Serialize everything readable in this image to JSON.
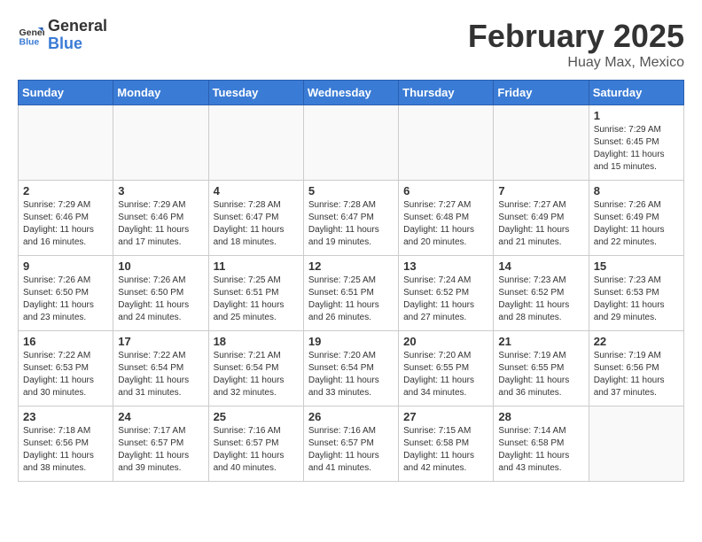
{
  "header": {
    "logo_line1": "General",
    "logo_line2": "Blue",
    "title": "February 2025",
    "subtitle": "Huay Max, Mexico"
  },
  "days_of_week": [
    "Sunday",
    "Monday",
    "Tuesday",
    "Wednesday",
    "Thursday",
    "Friday",
    "Saturday"
  ],
  "weeks": [
    [
      {
        "day": "",
        "info": ""
      },
      {
        "day": "",
        "info": ""
      },
      {
        "day": "",
        "info": ""
      },
      {
        "day": "",
        "info": ""
      },
      {
        "day": "",
        "info": ""
      },
      {
        "day": "",
        "info": ""
      },
      {
        "day": "1",
        "info": "Sunrise: 7:29 AM\nSunset: 6:45 PM\nDaylight: 11 hours and 15 minutes."
      }
    ],
    [
      {
        "day": "2",
        "info": "Sunrise: 7:29 AM\nSunset: 6:46 PM\nDaylight: 11 hours and 16 minutes."
      },
      {
        "day": "3",
        "info": "Sunrise: 7:29 AM\nSunset: 6:46 PM\nDaylight: 11 hours and 17 minutes."
      },
      {
        "day": "4",
        "info": "Sunrise: 7:28 AM\nSunset: 6:47 PM\nDaylight: 11 hours and 18 minutes."
      },
      {
        "day": "5",
        "info": "Sunrise: 7:28 AM\nSunset: 6:47 PM\nDaylight: 11 hours and 19 minutes."
      },
      {
        "day": "6",
        "info": "Sunrise: 7:27 AM\nSunset: 6:48 PM\nDaylight: 11 hours and 20 minutes."
      },
      {
        "day": "7",
        "info": "Sunrise: 7:27 AM\nSunset: 6:49 PM\nDaylight: 11 hours and 21 minutes."
      },
      {
        "day": "8",
        "info": "Sunrise: 7:26 AM\nSunset: 6:49 PM\nDaylight: 11 hours and 22 minutes."
      }
    ],
    [
      {
        "day": "9",
        "info": "Sunrise: 7:26 AM\nSunset: 6:50 PM\nDaylight: 11 hours and 23 minutes."
      },
      {
        "day": "10",
        "info": "Sunrise: 7:26 AM\nSunset: 6:50 PM\nDaylight: 11 hours and 24 minutes."
      },
      {
        "day": "11",
        "info": "Sunrise: 7:25 AM\nSunset: 6:51 PM\nDaylight: 11 hours and 25 minutes."
      },
      {
        "day": "12",
        "info": "Sunrise: 7:25 AM\nSunset: 6:51 PM\nDaylight: 11 hours and 26 minutes."
      },
      {
        "day": "13",
        "info": "Sunrise: 7:24 AM\nSunset: 6:52 PM\nDaylight: 11 hours and 27 minutes."
      },
      {
        "day": "14",
        "info": "Sunrise: 7:23 AM\nSunset: 6:52 PM\nDaylight: 11 hours and 28 minutes."
      },
      {
        "day": "15",
        "info": "Sunrise: 7:23 AM\nSunset: 6:53 PM\nDaylight: 11 hours and 29 minutes."
      }
    ],
    [
      {
        "day": "16",
        "info": "Sunrise: 7:22 AM\nSunset: 6:53 PM\nDaylight: 11 hours and 30 minutes."
      },
      {
        "day": "17",
        "info": "Sunrise: 7:22 AM\nSunset: 6:54 PM\nDaylight: 11 hours and 31 minutes."
      },
      {
        "day": "18",
        "info": "Sunrise: 7:21 AM\nSunset: 6:54 PM\nDaylight: 11 hours and 32 minutes."
      },
      {
        "day": "19",
        "info": "Sunrise: 7:20 AM\nSunset: 6:54 PM\nDaylight: 11 hours and 33 minutes."
      },
      {
        "day": "20",
        "info": "Sunrise: 7:20 AM\nSunset: 6:55 PM\nDaylight: 11 hours and 34 minutes."
      },
      {
        "day": "21",
        "info": "Sunrise: 7:19 AM\nSunset: 6:55 PM\nDaylight: 11 hours and 36 minutes."
      },
      {
        "day": "22",
        "info": "Sunrise: 7:19 AM\nSunset: 6:56 PM\nDaylight: 11 hours and 37 minutes."
      }
    ],
    [
      {
        "day": "23",
        "info": "Sunrise: 7:18 AM\nSunset: 6:56 PM\nDaylight: 11 hours and 38 minutes."
      },
      {
        "day": "24",
        "info": "Sunrise: 7:17 AM\nSunset: 6:57 PM\nDaylight: 11 hours and 39 minutes."
      },
      {
        "day": "25",
        "info": "Sunrise: 7:16 AM\nSunset: 6:57 PM\nDaylight: 11 hours and 40 minutes."
      },
      {
        "day": "26",
        "info": "Sunrise: 7:16 AM\nSunset: 6:57 PM\nDaylight: 11 hours and 41 minutes."
      },
      {
        "day": "27",
        "info": "Sunrise: 7:15 AM\nSunset: 6:58 PM\nDaylight: 11 hours and 42 minutes."
      },
      {
        "day": "28",
        "info": "Sunrise: 7:14 AM\nSunset: 6:58 PM\nDaylight: 11 hours and 43 minutes."
      },
      {
        "day": "",
        "info": ""
      }
    ]
  ]
}
